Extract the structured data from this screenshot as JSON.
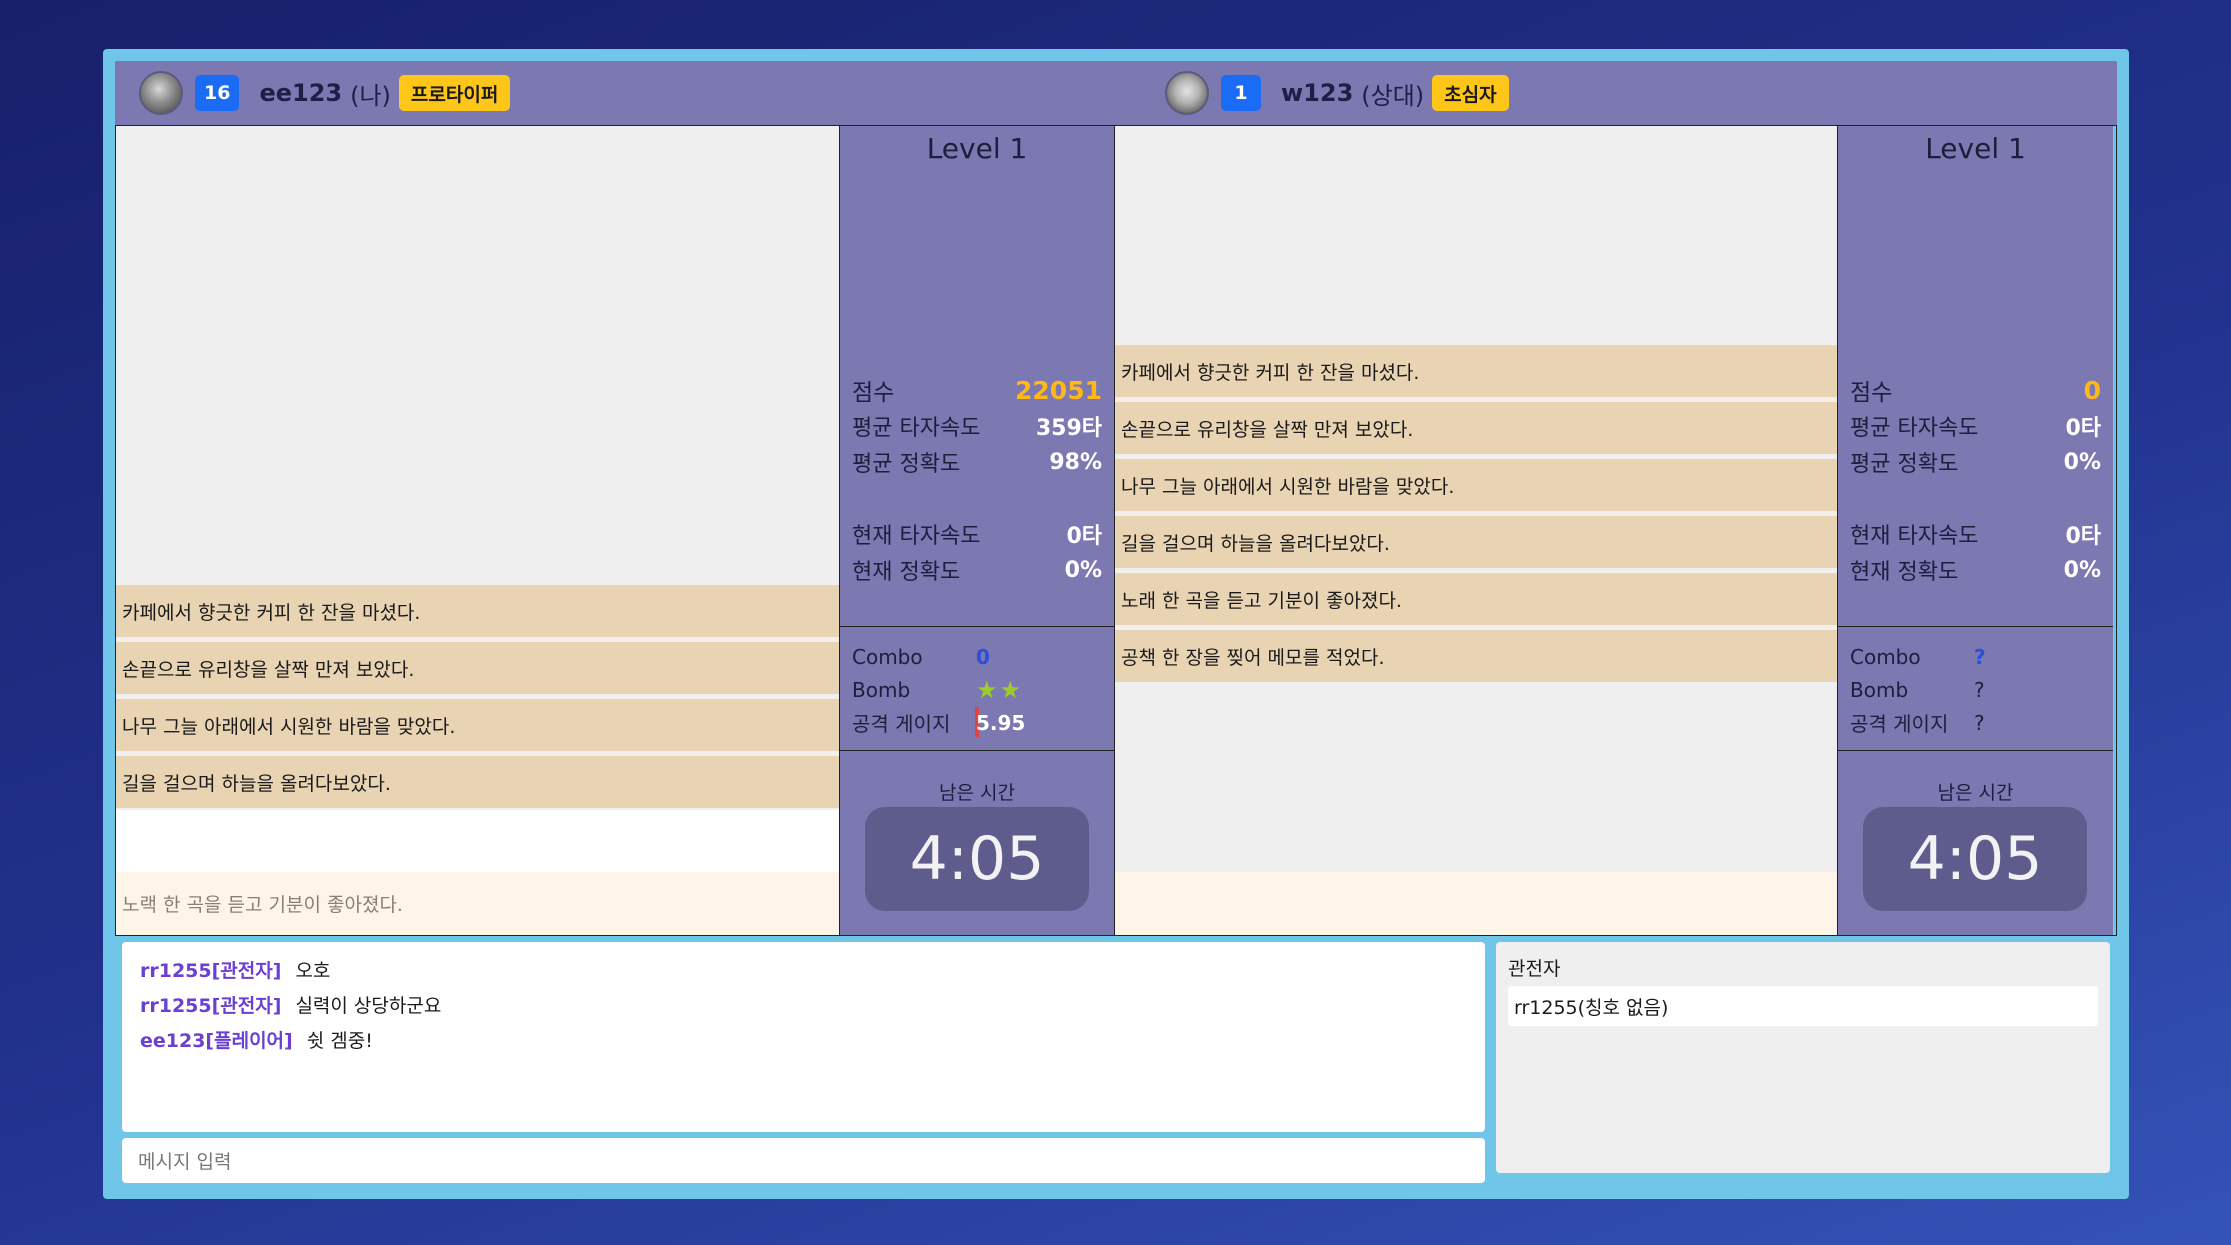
{
  "players": [
    {
      "avatar_icon": "player-avatar-icon",
      "level": "16",
      "name": "ee123",
      "tag": "(나)",
      "title_badge": "프로타이퍼",
      "level_label": "Level 1",
      "stats": {
        "score_label": "점수",
        "score": "22051",
        "avg_speed_label": "평균 타자속도",
        "avg_speed": "359타",
        "avg_acc_label": "평균 정확도",
        "avg_acc": "98%",
        "cur_speed_label": "현재 타자속도",
        "cur_speed": "0타",
        "cur_acc_label": "현재 정확도",
        "cur_acc": "0%"
      },
      "combo_label": "Combo",
      "combo": "0",
      "bomb_label": "Bomb",
      "bomb_stars": 2,
      "gauge_label": "공격 게이지",
      "gauge": "5.95",
      "remaining_label": "남은 시간",
      "timer": "4:05",
      "words": [
        "카페에서 향긋한 커피 한 잔을 마셨다.",
        "손끝으로 유리창을 살짝 만져 보았다.",
        "나무 그늘 아래에서 시원한 바람을 맞았다.",
        "길을 걸으며 하늘을 올려다보았다."
      ],
      "input_value": "",
      "next_hint": "노랙 한 곡을 듣고 기분이 좋아졌다."
    },
    {
      "avatar_icon": "moon-avatar-icon",
      "level": "1",
      "name": "w123",
      "tag": "(상대)",
      "title_badge": "초심자",
      "level_label": "Level 1",
      "stats": {
        "score_label": "점수",
        "score": "0",
        "avg_speed_label": "평균 타자속도",
        "avg_speed": "0타",
        "avg_acc_label": "평균 정확도",
        "avg_acc": "0%",
        "cur_speed_label": "현재 타자속도",
        "cur_speed": "0타",
        "cur_acc_label": "현재 정확도",
        "cur_acc": "0%"
      },
      "combo_label": "Combo",
      "combo": "?",
      "bomb_label": "Bomb",
      "bomb": "?",
      "gauge_label": "공격 게이지",
      "gauge": "?",
      "remaining_label": "남은 시간",
      "timer": "4:05",
      "words": [
        "카페에서 향긋한 커피 한 잔을 마셨다.",
        "손끝으로 유리창을 살짝 만져 보았다.",
        "나무 그늘 아래에서 시원한 바람을 맞았다.",
        "길을 걸으며 하늘을 올려다보았다.",
        "노래 한 곡을 듣고 기분이 좋아졌다.",
        "공책 한 장을 찢어 메모를 적었다."
      ]
    }
  ],
  "chat": {
    "messages": [
      {
        "who": "rr1255[관전자]",
        "text": "오호"
      },
      {
        "who": "rr1255[관전자]",
        "text": "실력이 상당하군요"
      },
      {
        "who": "ee123[플레이어]",
        "text": "쉿 겜중!"
      }
    ],
    "input_placeholder": "메시지 입력"
  },
  "spectators": {
    "title": "관전자",
    "list": [
      "rr1255(칭호 없음)"
    ]
  },
  "colors": {
    "panel": "#7b78b2",
    "word_bg": "#e8d3b3",
    "level_badge": "#1a6cf5",
    "title_badge": "#ffc61a",
    "score": "#ffb71a"
  }
}
